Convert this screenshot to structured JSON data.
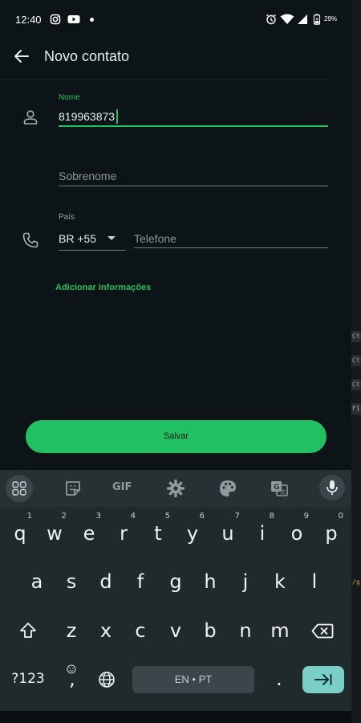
{
  "status_bar": {
    "time": "12:40",
    "battery": "29%"
  },
  "app_bar": {
    "title": "Novo contato",
    "back_icon": "arrow-left-icon"
  },
  "form": {
    "nome_label": "Nome",
    "nome_value": "819963873",
    "sobrenome_placeholder": "Sobrenome",
    "pais_label": "País",
    "pais_value": "BR +55",
    "telefone_placeholder": "Telefone",
    "add_info": "Adicionar informações",
    "save_label": "Salvar"
  },
  "keyboard": {
    "gif_label": "GIF",
    "row1": [
      {
        "k": "q",
        "h": "1"
      },
      {
        "k": "w",
        "h": "2"
      },
      {
        "k": "e",
        "h": "3"
      },
      {
        "k": "r",
        "h": "4"
      },
      {
        "k": "t",
        "h": "5"
      },
      {
        "k": "y",
        "h": "6"
      },
      {
        "k": "u",
        "h": "7"
      },
      {
        "k": "i",
        "h": "8"
      },
      {
        "k": "o",
        "h": "9"
      },
      {
        "k": "p",
        "h": "0"
      }
    ],
    "row2": [
      "a",
      "s",
      "d",
      "f",
      "g",
      "h",
      "j",
      "k",
      "l"
    ],
    "row3": [
      "z",
      "x",
      "c",
      "v",
      "b",
      "n",
      "m"
    ],
    "symbols_label": "?123",
    "comma": ",",
    "space_label": "EN • PT",
    "period": "."
  },
  "side_strip": [
    "Ct",
    "Ct",
    "Ct",
    "F1",
    "/g"
  ],
  "colors": {
    "accent": "#21c063",
    "background": "#0c1417",
    "keyboard": "#202a2d"
  }
}
